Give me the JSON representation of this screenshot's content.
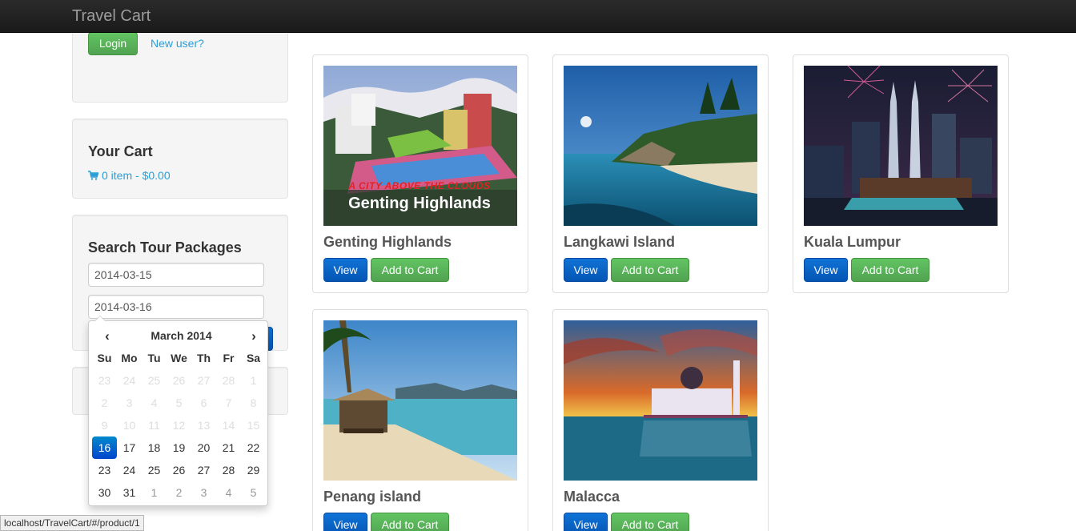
{
  "navbar": {
    "brand": "Travel Cart"
  },
  "login": {
    "login_label": "Login",
    "new_user_label": "New user?"
  },
  "cart": {
    "title": "Your Cart",
    "summary": "0 item - $0.00"
  },
  "search": {
    "title": "Search Tour Packages",
    "start_date": "2014-03-15",
    "end_date": "2014-03-16"
  },
  "datepicker": {
    "prev": "‹",
    "next": "›",
    "title": "March 2014",
    "weekdays": [
      "Su",
      "Mo",
      "Tu",
      "We",
      "Th",
      "Fr",
      "Sa"
    ],
    "weeks": [
      [
        "23",
        "24",
        "25",
        "26",
        "27",
        "28",
        "1"
      ],
      [
        "2",
        "3",
        "4",
        "5",
        "6",
        "7",
        "8"
      ],
      [
        "9",
        "10",
        "11",
        "12",
        "13",
        "14",
        "15"
      ],
      [
        "16",
        "17",
        "18",
        "19",
        "20",
        "21",
        "22"
      ],
      [
        "23",
        "24",
        "25",
        "26",
        "27",
        "28",
        "29"
      ],
      [
        "30",
        "31",
        "1",
        "2",
        "3",
        "4",
        "5"
      ]
    ],
    "selected_day": "16"
  },
  "products": [
    {
      "name": "Genting Highlands",
      "view_label": "View",
      "cart_label": "Add to Cart",
      "image_caption_top": "A CITY ABOVE THE CLOUDS",
      "image_caption_bottom": "Genting Highlands"
    },
    {
      "name": "Langkawi Island",
      "view_label": "View",
      "cart_label": "Add to Cart"
    },
    {
      "name": "Kuala Lumpur",
      "view_label": "View",
      "cart_label": "Add to Cart"
    },
    {
      "name": "Penang island",
      "view_label": "View",
      "cart_label": "Add to Cart"
    },
    {
      "name": "Malacca",
      "view_label": "View",
      "cart_label": "Add to Cart"
    }
  ],
  "statusbar": {
    "url": "localhost/TravelCart/#/product/1"
  },
  "colors": {
    "success": "#5cb85c",
    "primary": "#0a63c9",
    "link": "#2a9fd6",
    "navbar": "#222222"
  }
}
